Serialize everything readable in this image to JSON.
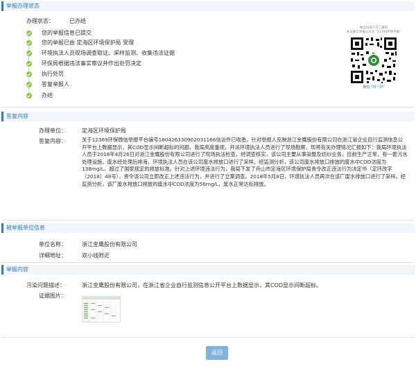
{
  "sections": {
    "status": "举报办理状态",
    "reply": "答复内容",
    "reported_unit": "被举报单位信息",
    "report": "举报内容"
  },
  "status": {
    "label": "办理状态：",
    "value": "已办结",
    "timeline": [
      "您的举报信息已提交",
      "您的举报已由 定海区环境保护局 受理",
      "环境执法人员现场调查取证、采样监测、收集违法证据",
      "环保局根据违法事实审议并作出处罚决定",
      "执行处罚",
      "答复举报人",
      "办结"
    ]
  },
  "qr": {
    "caption_top_1": "微信扫描下方二维码",
    "caption_top_2": "关注微信举报公众号 \"12369环保举报\"",
    "caption_bottom": "微信 \"扫一扫\""
  },
  "reply": {
    "unit_label": "办理单位：",
    "unit_value": "定海区环境保护局",
    "content_label": "答复内容：",
    "content_value": "关于12369环保微信举报平台编号180426330902031166信访件已收悉，针对举报人反映浙江金鹰股份有限公司在浙江省企业自行监测信息公开平台上数据显示，其COD显示间断超标的问题，我局高度重视，并派环境执法人员进行了现场勘察，现将有关办理情况汇报如下：我局环境执法人员于2018年4月26日对浙江金鹰股份有限公司进行了现场执法检查。经调查核实，该公司主要从事染整及纺纱业务，目前生产正常，有一套污水处理设施，废水经处理后排海，环境执法人员在该公司废水排放口进行了采样。经监测分析，该公司废水排放口排放的废水中COD浓度为138mg/L，超过了国家规定的排放标准。针对上述环境违法行为，我局下发了舟山市定海区环境保护局责令改正违法行为决定书（定环改字〔2018〕48号），责令该公司立即改正上述违法行为，并进行了立案调查。2018年5月8日，环境执法人员再次在该厂废水排放口进行了采样。经监测分析，该厂废水排放口排放的废水中COD浓度为56mg/L，废水正常达标排放。"
  },
  "reported_unit": {
    "name_label": "单位名称：",
    "name_value": "浙江金鹰股份有限公司",
    "address_label": "详细地址：",
    "address_value": "双小线附近"
  },
  "report": {
    "problem_label": "污染问题描述：",
    "problem_value": "浙江金鹰股份有限公司，在浙江省企业自行监测信息公开平台上数据显示，其COD显示间断超标。",
    "photo_label": "证据图片："
  },
  "buttons": {
    "back": "返回"
  },
  "colors": {
    "accent": "#2e7bc4",
    "check_green": "#8cc63f",
    "button": "#7fb2dd"
  }
}
